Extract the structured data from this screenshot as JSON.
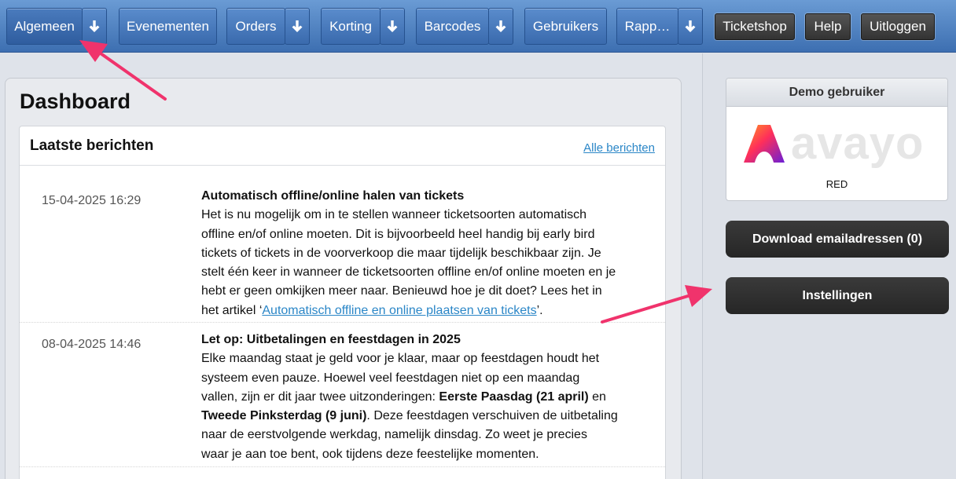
{
  "nav": {
    "algemeen": "Algemeen",
    "evenementen": "Evenementen",
    "orders": "Orders",
    "korting": "Korting",
    "barcodes": "Barcodes",
    "gebruikers": "Gebruikers",
    "rapp": "Rapp…",
    "ticketshop": "Ticketshop",
    "help": "Help",
    "uitloggen": "Uitloggen"
  },
  "page": {
    "title": "Dashboard"
  },
  "news": {
    "title": "Laatste berichten",
    "all_link": "Alle berichten",
    "items": [
      {
        "date": "15-04-2025 16:29",
        "headline": "Automatisch offline/online halen van tickets",
        "text": "Het is nu mogelijk om in te stellen wanneer ticketsoorten automatisch offline en/of online moeten. Dit is bijvoorbeeld heel handig bij early bird tickets of tickets in de voorverkoop die maar tijdelijk beschikbaar zijn. Je stelt één keer in wanneer de ticketsoorten offline en/of online moeten en je hebt er geen omkijken meer naar. Benieuwd hoe je dit doet? Lees het in het artikel ‘",
        "link": "Automatisch offline en online plaatsen van tickets",
        "after": "’."
      },
      {
        "date": "08-04-2025 14:46",
        "headline": "Let op: Uitbetalingen en feestdagen in 2025",
        "text1": "Elke maandag staat je geld voor je klaar, maar op feestdagen houdt het systeem even pauze. Hoewel veel feestdagen niet op een maandag vallen, zijn er dit jaar twee uitzonderingen: ",
        "bold1": "Eerste Paasdag (21 april)",
        "mid": " en ",
        "bold2": "Tweede Pinksterdag (9 juni)",
        "text2": ". Deze feestdagen verschuiven de uitbetaling naar de eerstvolgende werkdag, namelijk dinsdag. Zo weet je precies waar je aan toe bent, ook tijdens deze feestelijke momenten."
      }
    ]
  },
  "side": {
    "demo_title": "Demo gebruiker",
    "logo_text": "avayo",
    "plan": "RED",
    "download_button": "Download emailadressen (0)",
    "settings_button": "Instellingen"
  },
  "colors": {
    "nav_blue": "#4a7bbd",
    "link": "#2a86c7",
    "arrow": "#f0336c",
    "dark_button": "#2e2e2e"
  }
}
